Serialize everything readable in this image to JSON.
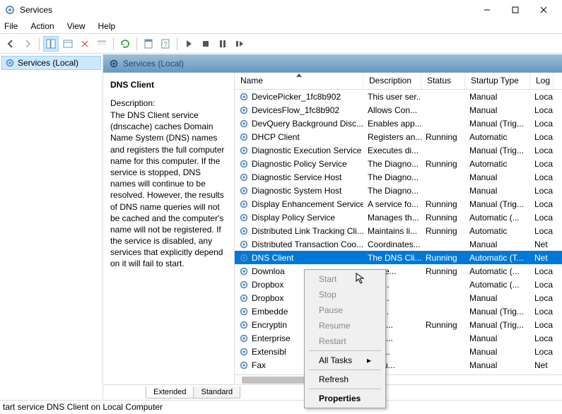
{
  "window": {
    "title": "Services"
  },
  "menu": {
    "file": "File",
    "action": "Action",
    "view": "View",
    "help": "Help"
  },
  "tree": {
    "root": "Services (Local)"
  },
  "pane": {
    "header": "Services (Local)"
  },
  "selected_service": {
    "name": "DNS Client",
    "desc_label": "Description:",
    "desc": "The DNS Client service (dnscache) caches Domain Name System (DNS) names and registers the full computer name for this computer. If the service is stopped, DNS names will continue to be resolved. However, the results of DNS name queries will not be cached and the computer's name will not be registered. If the service is disabled, any services that explicitly depend on it will fail to start."
  },
  "columns": {
    "name": "Name",
    "description": "Description",
    "status": "Status",
    "startup": "Startup Type",
    "logon": "Log"
  },
  "rows": [
    {
      "name": "DevicePicker_1fc8b902",
      "desc": "This user ser...",
      "status": "",
      "startup": "Manual",
      "logon": "Loca"
    },
    {
      "name": "DevicesFlow_1fc8b902",
      "desc": "Allows Con...",
      "status": "",
      "startup": "Manual",
      "logon": "Loca"
    },
    {
      "name": "DevQuery Background Disc...",
      "desc": "Enables app...",
      "status": "",
      "startup": "Manual (Trig...",
      "logon": "Loca"
    },
    {
      "name": "DHCP Client",
      "desc": "Registers an...",
      "status": "Running",
      "startup": "Automatic",
      "logon": "Loca"
    },
    {
      "name": "Diagnostic Execution Service",
      "desc": "Executes di...",
      "status": "",
      "startup": "Manual (Trig...",
      "logon": "Loca"
    },
    {
      "name": "Diagnostic Policy Service",
      "desc": "The Diagno...",
      "status": "Running",
      "startup": "Automatic",
      "logon": "Loca"
    },
    {
      "name": "Diagnostic Service Host",
      "desc": "The Diagno...",
      "status": "",
      "startup": "Manual",
      "logon": "Loca"
    },
    {
      "name": "Diagnostic System Host",
      "desc": "The Diagno...",
      "status": "",
      "startup": "Manual",
      "logon": "Loca"
    },
    {
      "name": "Display Enhancement Service",
      "desc": "A service fo...",
      "status": "Running",
      "startup": "Manual (Trig...",
      "logon": "Loca"
    },
    {
      "name": "Display Policy Service",
      "desc": "Manages th...",
      "status": "Running",
      "startup": "Automatic (...",
      "logon": "Loca"
    },
    {
      "name": "Distributed Link Tracking Cli...",
      "desc": "Maintains li...",
      "status": "Running",
      "startup": "Automatic",
      "logon": "Loca"
    },
    {
      "name": "Distributed Transaction Coo...",
      "desc": "Coordinates...",
      "status": "",
      "startup": "Manual",
      "logon": "Net"
    },
    {
      "name": "DNS Client",
      "desc": "The DNS Cli...",
      "status": "Running",
      "startup": "Automatic (T...",
      "logon": "Net",
      "selected": true
    },
    {
      "name": "Downloa",
      "desc": "ws se...",
      "status": "Running",
      "startup": "Automatic (...",
      "logon": "Loca"
    },
    {
      "name": "Dropbox",
      "desc": "our ...",
      "status": "",
      "startup": "Automatic (...",
      "logon": "Loca"
    },
    {
      "name": "Dropbox",
      "desc": "our ...",
      "status": "",
      "startup": "Manual",
      "logon": "Loca"
    },
    {
      "name": "Embedde",
      "desc": "bed...",
      "status": "",
      "startup": "Manual (Trig...",
      "logon": "Loca"
    },
    {
      "name": "Encryptin",
      "desc": "es th...",
      "status": "Running",
      "startup": "Manual (Trig...",
      "logon": "Loca"
    },
    {
      "name": "Enterprise",
      "desc": "s ent...",
      "status": "",
      "startup": "Manual",
      "logon": "Loca"
    },
    {
      "name": "Extensibl",
      "desc": "ensi...",
      "status": "",
      "startup": "Manual",
      "logon": "Loca"
    },
    {
      "name": "Fax",
      "desc": "s you...",
      "status": "",
      "startup": "Manual",
      "logon": "Net"
    }
  ],
  "tabs": {
    "extended": "Extended",
    "standard": "Standard"
  },
  "context_menu": {
    "start": "Start",
    "stop": "Stop",
    "pause": "Pause",
    "resume": "Resume",
    "restart": "Restart",
    "all_tasks": "All Tasks",
    "refresh": "Refresh",
    "properties": "Properties"
  },
  "statusbar": "tart service DNS Client on Local Computer"
}
